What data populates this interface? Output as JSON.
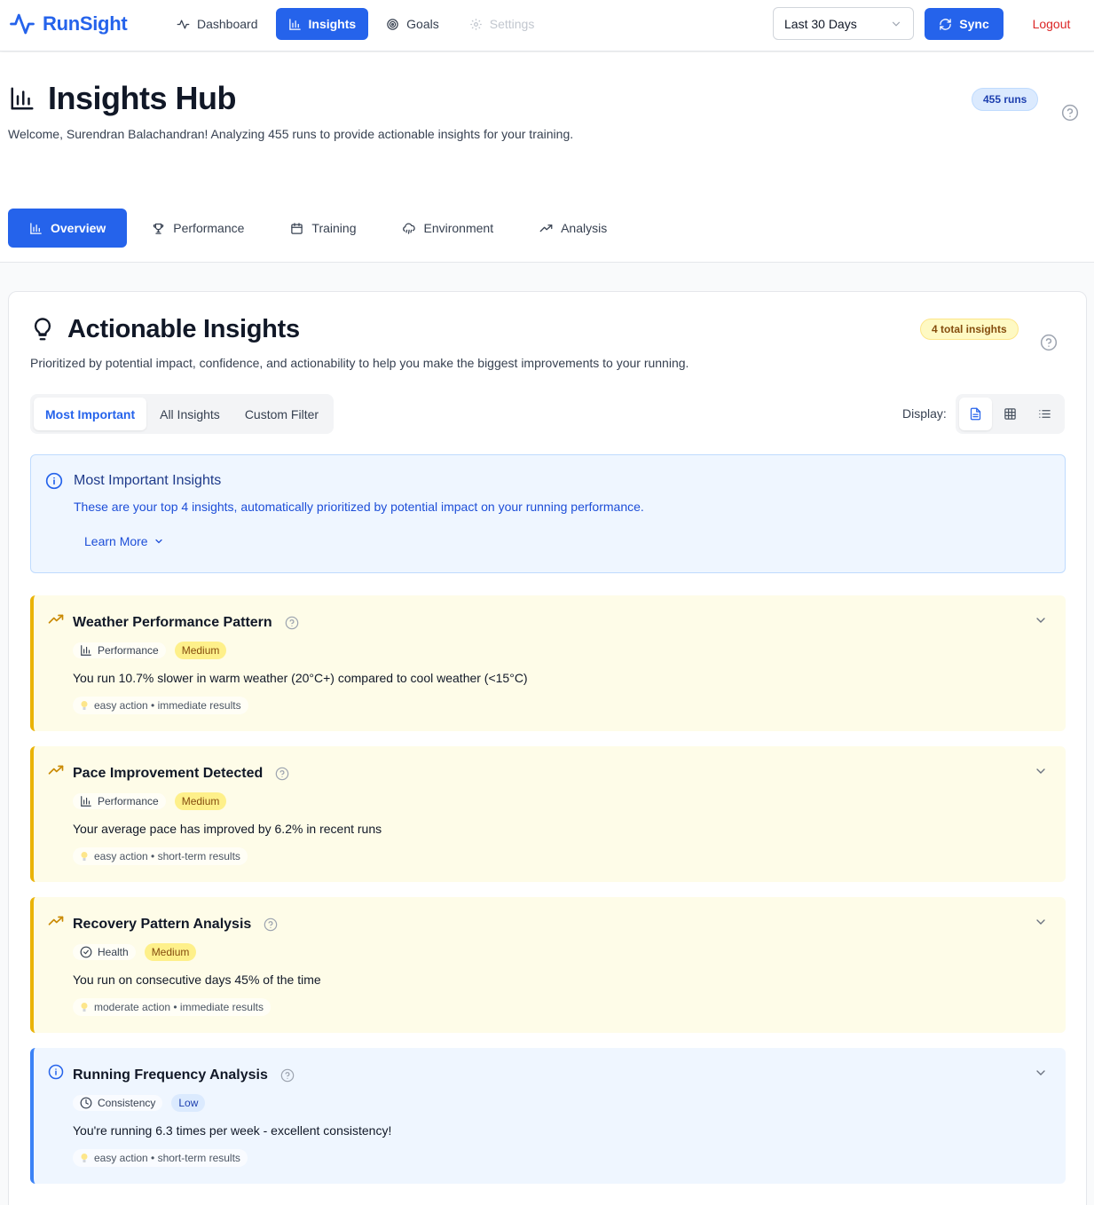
{
  "app": {
    "name": "RunSight"
  },
  "nav": {
    "items": [
      {
        "label": "Dashboard",
        "icon": "activity-icon"
      },
      {
        "label": "Insights",
        "icon": "bar-chart-icon"
      },
      {
        "label": "Goals",
        "icon": "target-icon"
      },
      {
        "label": "Settings",
        "icon": "gear-icon"
      }
    ],
    "active": "Insights"
  },
  "header": {
    "date_range": "Last 30 Days",
    "sync_label": "Sync",
    "logout_label": "Logout"
  },
  "hub": {
    "title": "Insights Hub",
    "subtitle": "Welcome, Surendran Balachandran! Analyzing 455 runs to provide actionable insights for your training.",
    "runs_badge": "455 runs",
    "tabs": [
      {
        "label": "Overview"
      },
      {
        "label": "Performance"
      },
      {
        "label": "Training"
      },
      {
        "label": "Environment"
      },
      {
        "label": "Analysis"
      }
    ]
  },
  "actionable": {
    "title": "Actionable Insights",
    "subtitle": "Prioritized by potential impact, confidence, and actionability to help you make the biggest improvements to your running.",
    "total_badge": "4 total insights",
    "filters": [
      "Most Important",
      "All Insights",
      "Custom Filter"
    ],
    "display_label": "Display:",
    "info": {
      "title": "Most Important Insights",
      "text": "These are your top 4 insights, automatically prioritized by potential impact on your running performance.",
      "learn_more": "Learn More"
    },
    "insights": [
      {
        "title": "Weather Performance Pattern",
        "category": "Performance",
        "priority": "Medium",
        "description": "You run 10.7% slower in warm weather (20°C+) compared to cool weather (<15°C)",
        "meta": "easy action • immediate results"
      },
      {
        "title": "Pace Improvement Detected",
        "category": "Performance",
        "priority": "Medium",
        "description": "Your average pace has improved by 6.2% in recent runs",
        "meta": "easy action • short-term results"
      },
      {
        "title": "Recovery Pattern Analysis",
        "category": "Health",
        "priority": "Medium",
        "description": "You run on consecutive days 45% of the time",
        "meta": "moderate action • immediate results"
      },
      {
        "title": "Running Frequency Analysis",
        "category": "Consistency",
        "priority": "Low",
        "description": "You're running 6.3 times per week - excellent consistency!",
        "meta": "easy action • short-term results"
      }
    ]
  },
  "colors": {
    "primary": "#2563eb",
    "warning_accent": "#eab308",
    "info_accent": "#3b82f6",
    "logout": "#dc2626"
  }
}
